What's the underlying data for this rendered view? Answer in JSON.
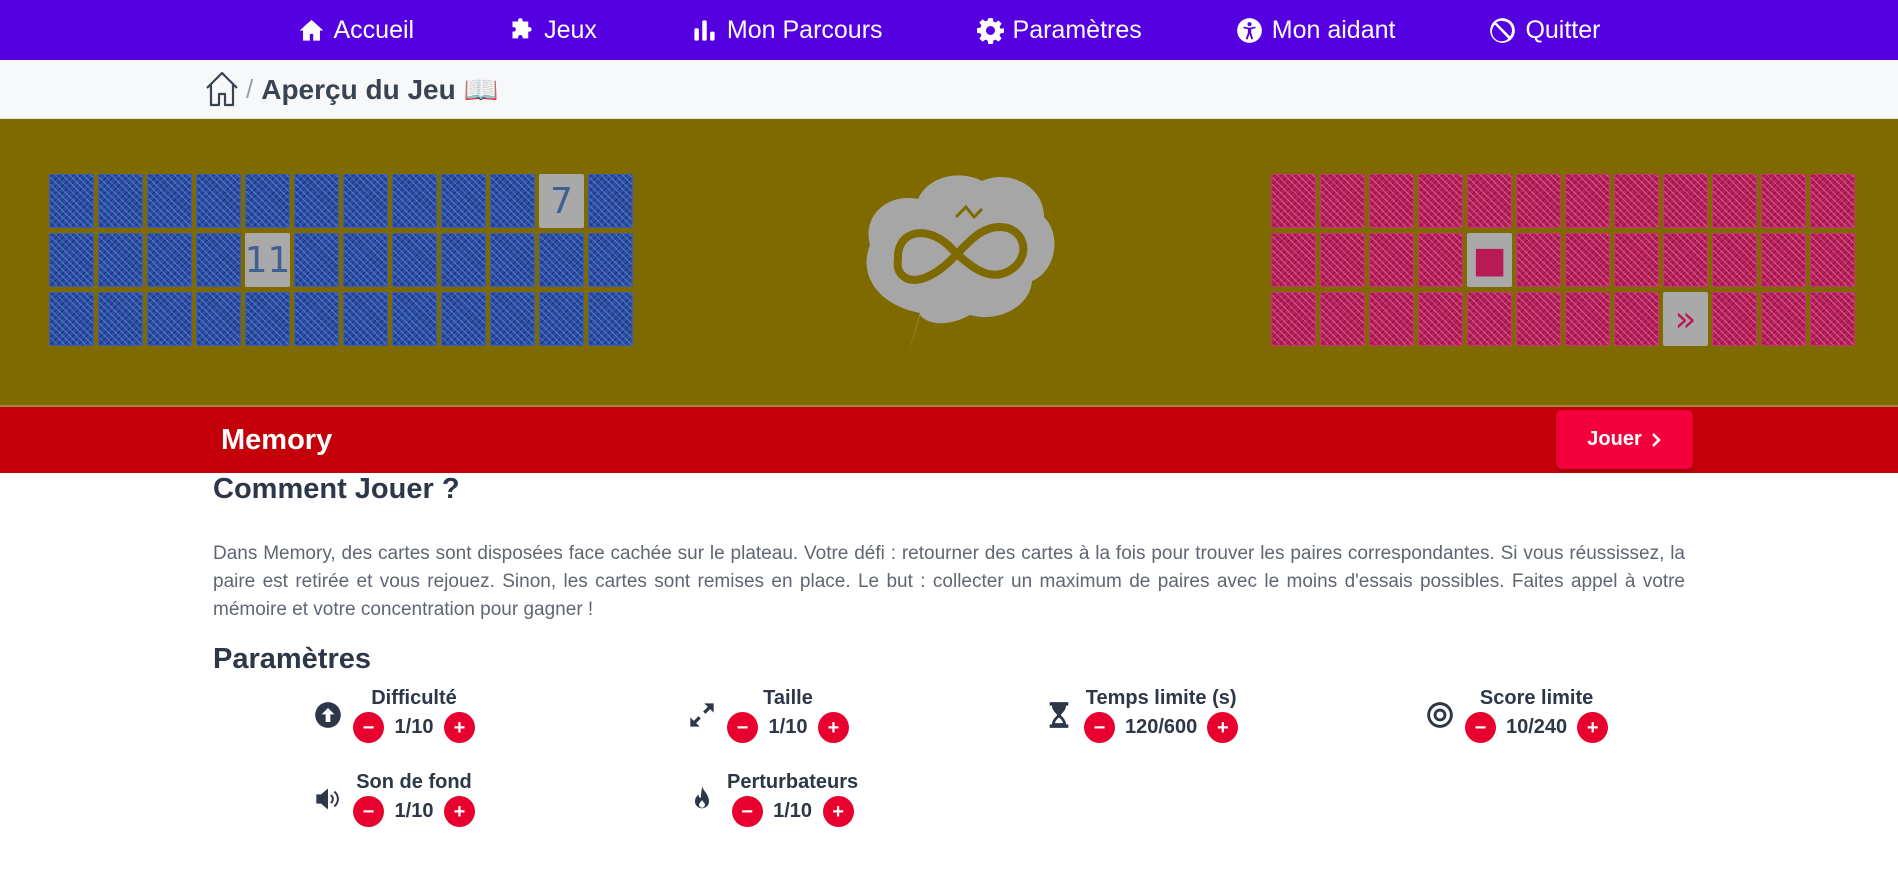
{
  "nav": {
    "items": [
      {
        "label": "Accueil",
        "icon": "home-icon"
      },
      {
        "label": "Jeux",
        "icon": "puzzle-icon"
      },
      {
        "label": "Mon Parcours",
        "icon": "chart-icon"
      },
      {
        "label": "Paramètres",
        "icon": "gear-icon"
      },
      {
        "label": "Mon aidant",
        "icon": "accessibility-icon"
      },
      {
        "label": "Quitter",
        "icon": "ban-icon"
      }
    ]
  },
  "breadcrumb": {
    "title": "Aperçu du Jeu 📖",
    "separator": "/"
  },
  "preview": {
    "left_face_top": "7",
    "left_face_middle": "11",
    "right_face_square": "■",
    "right_face_chevron": "»"
  },
  "game": {
    "name": "Memory",
    "play_label": "Jouer"
  },
  "how_to": {
    "heading": "Comment Jouer ?",
    "text": "Dans Memory, des cartes sont disposées face cachée sur le plateau. Votre défi : retourner des cartes à la fois pour trouver les paires correspondantes. Si vous réussissez, la paire est retirée et vous rejouez. Sinon, les cartes sont remises en place. Le but : collecter un maximum de paires avec le moins d'essais possibles. Faites appel à votre mémoire et votre concentration pour gagner !"
  },
  "params": {
    "heading": "Paramètres",
    "items": [
      {
        "label": "Difficulté",
        "value": "1/10",
        "icon": "arrow-up-circle-icon"
      },
      {
        "label": "Taille",
        "value": "1/10",
        "icon": "expand-icon"
      },
      {
        "label": "Temps limite (s)",
        "value": "120/600",
        "icon": "hourglass-icon"
      },
      {
        "label": "Score limite",
        "value": "10/240",
        "icon": "target-icon"
      },
      {
        "label": "Son de fond",
        "value": "1/10",
        "icon": "volume-icon"
      },
      {
        "label": "Perturbateurs",
        "value": "1/10",
        "icon": "fire-icon"
      }
    ],
    "minus": "−",
    "plus": "+"
  },
  "colors": {
    "nav": "#5400e0",
    "banner": "#7f6a00",
    "title_bar": "#c40008",
    "play_button": "#f3003c",
    "round_button": "#e8002f"
  }
}
